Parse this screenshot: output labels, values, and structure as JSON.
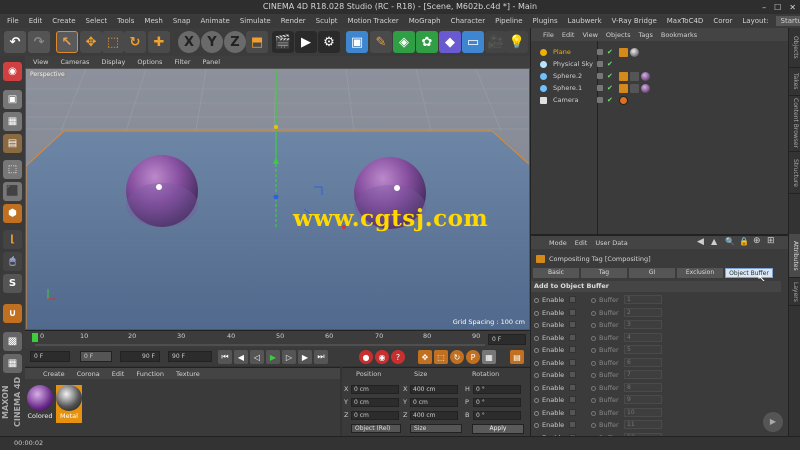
{
  "window": {
    "title": "CINEMA 4D R18.028 Studio (RC - R18) - [Scene, M602b.c4d *] - Main"
  },
  "menubar": {
    "items": [
      "File",
      "Edit",
      "Create",
      "Select",
      "Tools",
      "Mesh",
      "Snap",
      "Animate",
      "Simulate",
      "Render",
      "Sculpt",
      "Motion Tracker",
      "MoGraph",
      "Character",
      "Pipeline",
      "Plugins",
      "Laubwerk",
      "V-Ray Bridge",
      "MaxToC4D",
      "Coror"
    ],
    "layout_label": "Layout:",
    "layout_value": "Startup"
  },
  "viewport": {
    "menu": [
      "View",
      "Cameras",
      "Display",
      "Options",
      "Filter",
      "Panel"
    ],
    "camera_label": "Perspective",
    "grid_spacing": "Grid Spacing : 100 cm",
    "watermark": "www.cgtsj.com"
  },
  "timeline": {
    "ticks": [
      "0",
      "10",
      "20",
      "30",
      "40",
      "50",
      "60",
      "70",
      "80",
      "90"
    ],
    "end_field": "0 F"
  },
  "transport": {
    "start_frame": "0 F",
    "current_frame": "0 F",
    "end_frame": "90 F",
    "max_frame": "90 F"
  },
  "material_panel": {
    "menu": [
      "Create",
      "Corona",
      "Edit",
      "Function",
      "Texture"
    ],
    "materials": [
      {
        "name": "Colored"
      },
      {
        "name": "Metal"
      }
    ]
  },
  "coordinates": {
    "headers": [
      "Position",
      "Size",
      "Rotation"
    ],
    "rows": [
      {
        "axis": "X",
        "pos": "0 cm",
        "size_axis": "X",
        "size": "400 cm",
        "rot_axis": "H",
        "rot": "0 °"
      },
      {
        "axis": "Y",
        "pos": "0 cm",
        "size_axis": "Y",
        "size": "0 cm",
        "rot_axis": "P",
        "rot": "0 °"
      },
      {
        "axis": "Z",
        "pos": "0 cm",
        "size_axis": "Z",
        "size": "400 cm",
        "rot_axis": "B",
        "rot": "0 °"
      }
    ],
    "mode_dropdown": "Object (Rel)",
    "size_dropdown": "Size",
    "apply_label": "Apply"
  },
  "object_manager": {
    "menu": [
      "File",
      "Edit",
      "View",
      "Objects",
      "Tags",
      "Bookmarks"
    ],
    "objects": [
      {
        "name": "Plane",
        "color": "#f0b000"
      },
      {
        "name": "Physical Sky",
        "color": "#b9e4ff"
      },
      {
        "name": "Sphere.2",
        "color": "#6fc0ff"
      },
      {
        "name": "Sphere.1",
        "color": "#6fc0ff"
      },
      {
        "name": "Camera",
        "color": "#e0e0e0"
      }
    ]
  },
  "attribute_manager": {
    "menu": [
      "Mode",
      "Edit",
      "User Data"
    ],
    "title": "Compositing Tag [Compositing]",
    "tabs": [
      "Basic",
      "Tag",
      "GI",
      "Exclusion",
      "Object Buffer"
    ],
    "active_tab": "Object Buffer",
    "section": "Add to Object Buffer",
    "enable_label": "Enable",
    "buffer_label": "Buffer",
    "buffers": [
      "1",
      "2",
      "3",
      "4",
      "5",
      "6",
      "7",
      "8",
      "9",
      "10",
      "11",
      "12"
    ]
  },
  "side_tabs": [
    "Objects",
    "Takes",
    "Content Browser",
    "Structure",
    "Attributes",
    "Layers"
  ],
  "brand": "MAXON CINEMA 4D",
  "status": {
    "time": "00:00:02"
  }
}
